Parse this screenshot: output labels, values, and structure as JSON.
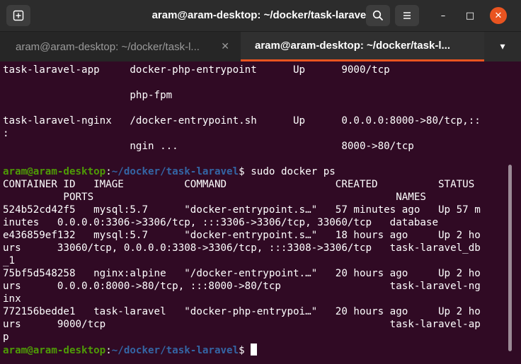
{
  "window": {
    "title": "aram@aram-desktop: ~/docker/task-laravel",
    "new_tab_icon": "new-tab-icon",
    "search_icon": "search-icon",
    "menu_icon": "hamburger-menu-icon",
    "minimize_symbol": "–",
    "maximize_symbol": "□",
    "close_symbol": "✕",
    "close_button_color": "#e95420"
  },
  "tabs": [
    {
      "label": "aram@aram-desktop: ~/docker/task-l...",
      "close": "✕",
      "active": false
    },
    {
      "label": "aram@aram-desktop: ~/docker/task-l...",
      "close": "✕",
      "active": true
    }
  ],
  "tab_menu_symbol": "▾",
  "terminal": {
    "background": "#300a24",
    "prompt_user_host": "aram@aram-desktop",
    "prompt_sep": ":",
    "prompt_path": "~/docker/task-laravel",
    "prompt_symbol": "$ ",
    "command": "sudo docker ps",
    "previous_output": [
      "task-laravel-app     docker-php-entrypoint      Up      9000/tcp",
      "",
      "                     php-fpm",
      "",
      "task-laravel-nginx   /docker-entrypoint.sh      Up      0.0.0.0:8000->80/tcp,::",
      ":",
      "                     ngin ...                           8000->80/tcp"
    ],
    "ps_output": [
      "CONTAINER ID   IMAGE          COMMAND                  CREATED          STATUS",
      "          PORTS                                                  NAMES",
      "524b52cd42f5   mysql:5.7      \"docker-entrypoint.s…\"   57 minutes ago   Up 57 m",
      "inutes   0.0.0.0:3306->3306/tcp, :::3306->3306/tcp, 33060/tcp   database",
      "e436859ef132   mysql:5.7      \"docker-entrypoint.s…\"   18 hours ago     Up 2 ho",
      "urs      33060/tcp, 0.0.0.0:3308->3306/tcp, :::3308->3306/tcp   task-laravel_db",
      "_1",
      "75bf5d548258   nginx:alpine   \"/docker-entrypoint.…\"   20 hours ago     Up 2 ho",
      "urs      0.0.0.0:8000->80/tcp, :::8000->80/tcp                  task-laravel-ng",
      "inx",
      "772156bedde1   task-laravel   \"docker-php-entrypoi…\"   20 hours ago     Up 2 ho",
      "urs      9000/tcp                                               task-laravel-ap",
      "p"
    ]
  }
}
